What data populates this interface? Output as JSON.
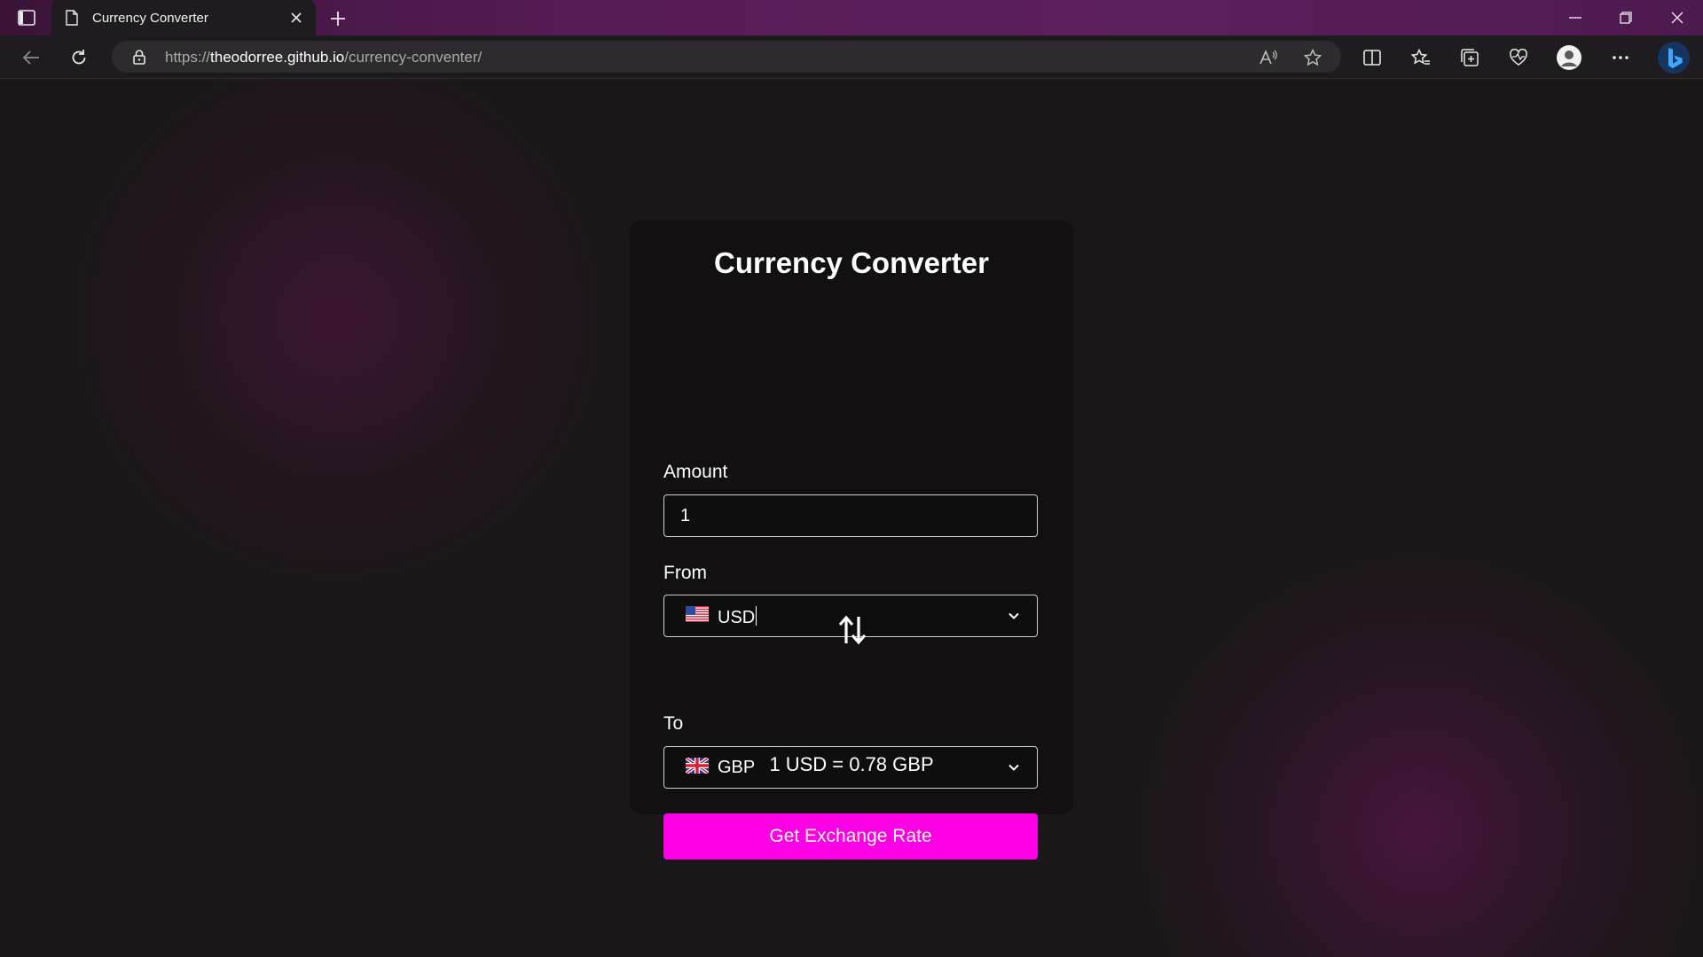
{
  "browser": {
    "tab_title": "Currency Converter",
    "url_prefix": "https://",
    "url_host": "theodorree.github.io",
    "url_path": "/currency-conventer/"
  },
  "app": {
    "title": "Currency Converter",
    "amount_label": "Amount",
    "amount_value": "1",
    "from_label": "From",
    "from_currency": "USD",
    "to_label": "To",
    "to_currency": "GBP",
    "result_text": "1 USD = 0.78 GBP",
    "button_label": "Get Exchange Rate"
  },
  "colors": {
    "accent": "#ff00e6",
    "card_bg": "#121011",
    "page_bg": "#1a1718",
    "titlebar": "#5a1d5a"
  },
  "icons": {
    "from_flag": "us-flag-icon",
    "to_flag": "uk-flag-icon",
    "swap": "swap-arrows-icon"
  }
}
